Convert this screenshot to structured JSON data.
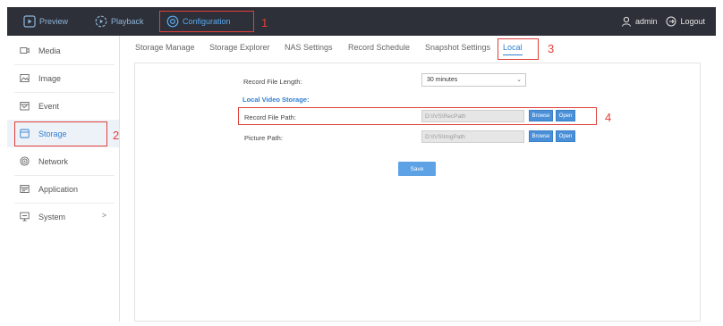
{
  "topbar": {
    "preview_label": "Preview",
    "playback_label": "Playback",
    "configuration_label": "Configuration",
    "user_label": "admin",
    "logout_label": "Logout",
    "background_color": "#2d3038",
    "accent_color": "#5aa9f0"
  },
  "sidebar": {
    "items": [
      {
        "label": "Media",
        "icon": "camera-icon"
      },
      {
        "label": "Image",
        "icon": "image-icon"
      },
      {
        "label": "Event",
        "icon": "event-icon"
      },
      {
        "label": "Storage",
        "icon": "storage-icon",
        "active": true
      },
      {
        "label": "Network",
        "icon": "network-icon"
      },
      {
        "label": "Application",
        "icon": "application-icon"
      },
      {
        "label": "System",
        "icon": "system-icon",
        "chevron": ">"
      }
    ]
  },
  "tabs": {
    "items": [
      "Storage Manage",
      "Storage Explorer",
      "NAS Settings",
      "Record Schedule",
      "Snapshot Settings",
      "Local"
    ],
    "active": "Local"
  },
  "form": {
    "record_file_length_label": "Record File Length:",
    "record_file_length_value": "30 minutes",
    "section_title": "Local Video Storage:",
    "record_file_path_label": "Record File Path:",
    "record_file_path_value": "D:\\IVS\\RecPath",
    "picture_path_label": "Picture Path:",
    "picture_path_value": "D:\\IVS\\ImgPath",
    "browse_label": "Browse",
    "open_label": "Open",
    "save_label": "Save"
  },
  "annotations": {
    "marker_1": "1",
    "marker_2": "2",
    "marker_3": "3",
    "marker_4": "4",
    "color": "#e0403a"
  }
}
